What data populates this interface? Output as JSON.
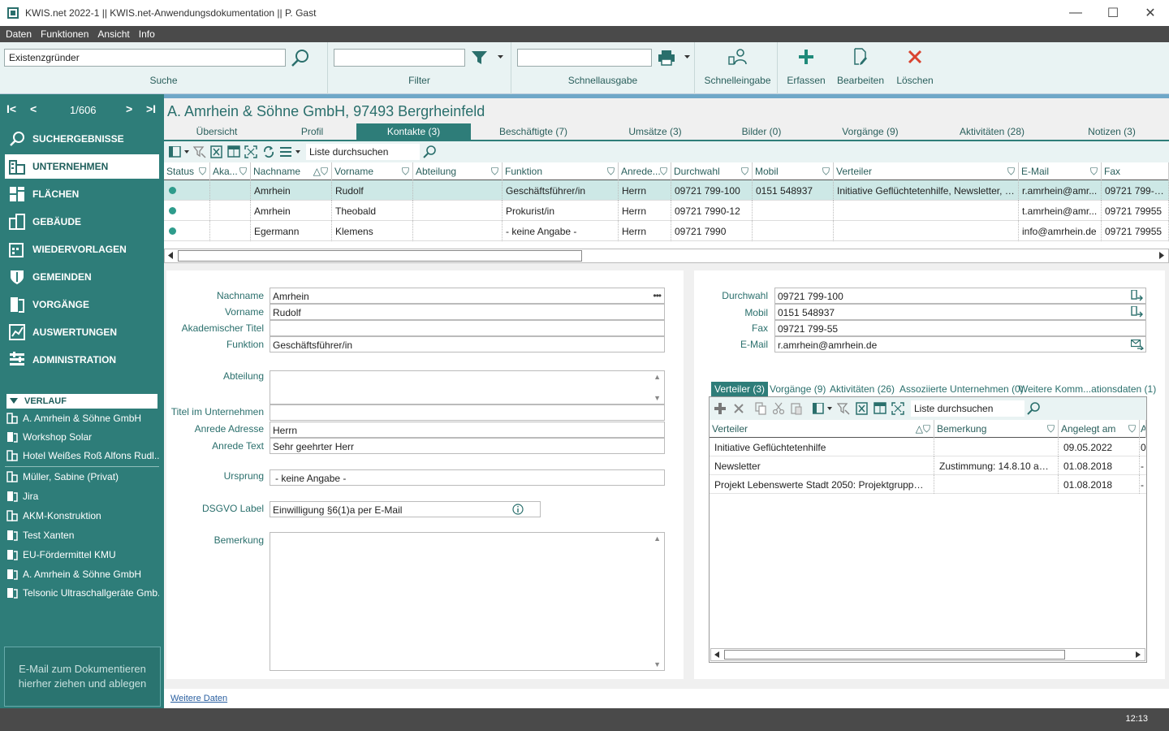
{
  "window": {
    "title": "KWIS.net 2022-1 || KWIS.net-Anwendungsdokumentation || P. Gast",
    "minimize": "—",
    "maximize": "☐",
    "close": "✕"
  },
  "menu": [
    "Daten",
    "Funktionen",
    "Ansicht",
    "Info"
  ],
  "ribbon": {
    "search": {
      "value": "Existenzgründer",
      "label": "Suche"
    },
    "filter": {
      "value": "",
      "label": "Filter"
    },
    "quickprint": {
      "value": "",
      "label": "Schnellausgabe"
    },
    "quickentry": {
      "label": "Schnelleingabe"
    },
    "create": {
      "label": "Erfassen"
    },
    "edit": {
      "label": "Bearbeiten"
    },
    "delete": {
      "label": "Löschen"
    }
  },
  "sidebar": {
    "pager": {
      "first": "I<",
      "prev": "<",
      "count": "1/606",
      "next": ">",
      "last": ">I"
    },
    "nav": [
      {
        "label": "SUCHERGEBNISSE",
        "icon": "magnifier-icon"
      },
      {
        "label": "UNTERNEHMEN",
        "icon": "buildings-icon"
      },
      {
        "label": "FLÄCHEN",
        "icon": "areas-icon"
      },
      {
        "label": "GEBÄUDE",
        "icon": "building-icon"
      },
      {
        "label": "WIEDERVORLAGEN",
        "icon": "calendar-icon"
      },
      {
        "label": "GEMEINDEN",
        "icon": "shield-icon"
      },
      {
        "label": "VORGÄNGE",
        "icon": "document-icon"
      },
      {
        "label": "AUSWERTUNGEN",
        "icon": "chart-icon"
      },
      {
        "label": "ADMINISTRATION",
        "icon": "admin-icon"
      }
    ],
    "history_title": "VERLAUF",
    "history": [
      "A. Amrhein & Söhne GmbH",
      "Workshop Solar",
      "Hotel Weißes Roß Alfons Rudl...",
      "Müller, Sabine (Privat)",
      "Jira",
      "AKM-Konstruktion",
      "Test Xanten",
      "EU-Fördermittel KMU",
      "A. Amrhein & Söhne GmbH",
      "Telsonic Ultraschallgeräte Gmb..."
    ],
    "dropzone_line1": "E-Mail  zum Dokumentieren",
    "dropzone_line2": "hierher ziehen und ablegen"
  },
  "main": {
    "company": "A. Amrhein & Söhne GmbH, 97493 Bergrheinfeld",
    "tabs": [
      "Übersicht",
      "Profil",
      "Kontakte (3)",
      "Beschäftigte (7)",
      "Umsätze (3)",
      "Bilder (0)",
      "Vorgänge (9)",
      "Aktivitäten (28)",
      "Notizen (3)"
    ],
    "grid_search": "Liste durchsuchen",
    "columns": [
      "Status",
      "Aka...",
      "Nachname",
      "Vorname",
      "Abteilung",
      "Funktion",
      "Anrede...",
      "Durchwahl",
      "Mobil",
      "Verteiler",
      "E-Mail",
      "Fax"
    ],
    "rows": [
      [
        "",
        "",
        "Amrhein",
        "Rudolf",
        "",
        "Geschäftsführer/in",
        "Herrn",
        "09721 799-100",
        "0151 548937",
        "Initiative Geflüchtetenhilfe, Newsletter, Pr...",
        "r.amrhein@amr...",
        "09721 799-55"
      ],
      [
        "",
        "",
        "Amrhein",
        "Theobald",
        "",
        "Prokurist/in",
        "Herrn",
        "09721 7990-12",
        "",
        "",
        "t.amrhein@amr...",
        "09721 79955"
      ],
      [
        "",
        "",
        "Egermann",
        "Klemens",
        "",
        "- keine Angabe -",
        "Herrn",
        "09721 7990",
        "",
        "",
        "info@amrhein.de",
        "09721 79955"
      ]
    ]
  },
  "detail": {
    "nachname": {
      "label": "Nachname",
      "value": "Amrhein"
    },
    "vorname": {
      "label": "Vorname",
      "value": "Rudolf"
    },
    "akad": {
      "label": "Akademischer Titel",
      "value": ""
    },
    "funktion": {
      "label": "Funktion",
      "value": "Geschäftsführer/in"
    },
    "abteilung": {
      "label": "Abteilung",
      "value": ""
    },
    "titel": {
      "label": "Titel im Unternehmen",
      "value": ""
    },
    "anrede_adresse": {
      "label": "Anrede Adresse",
      "value": "Herrn"
    },
    "anrede_text": {
      "label": "Anrede Text",
      "value": "Sehr geehrter Herr"
    },
    "ursprung": {
      "label": "Ursprung",
      "value": "- keine Angabe -"
    },
    "dsgvo": {
      "label": "DSGVO Label",
      "value": "Einwilligung §6(1)a per E-Mail"
    },
    "bemerkung": {
      "label": "Bemerkung",
      "value": ""
    },
    "weitere": "Weitere Daten",
    "dots": "•••"
  },
  "contact": {
    "durchwahl": {
      "label": "Durchwahl",
      "value": "09721 799-100"
    },
    "mobil": {
      "label": "Mobil",
      "value": "0151 548937"
    },
    "fax": {
      "label": "Fax",
      "value": "09721 799-55"
    },
    "email": {
      "label": "E-Mail",
      "value": "r.amrhein@amrhein.de"
    }
  },
  "subtabs": [
    "Verteiler (3)",
    "Vorgänge (9)",
    "Aktivitäten (26)",
    "Assoziierte Unternehmen (0)",
    "Weitere Komm...ationsdaten (1)"
  ],
  "subgrid": {
    "search": "Liste durchsuchen",
    "columns": [
      "Verteiler",
      "Bemerkung",
      "Angelegt am",
      "A"
    ],
    "rows": [
      [
        "Initiative Geflüchtetenhilfe",
        "",
        "09.05.2022",
        "0"
      ],
      [
        "Newsletter",
        "Zustimmung:  14.8.10  auf I...",
        "01.08.2018",
        "-"
      ],
      [
        "Projekt Lebenswerte Stadt 2050: Projektgruppe Mo...",
        "",
        "01.08.2018",
        "-"
      ]
    ]
  },
  "status": {
    "time": "12:13"
  },
  "colors": {
    "teal": "#2e7d79",
    "ribbon": "#e9f3f3",
    "selected_row": "#cde8e6"
  }
}
